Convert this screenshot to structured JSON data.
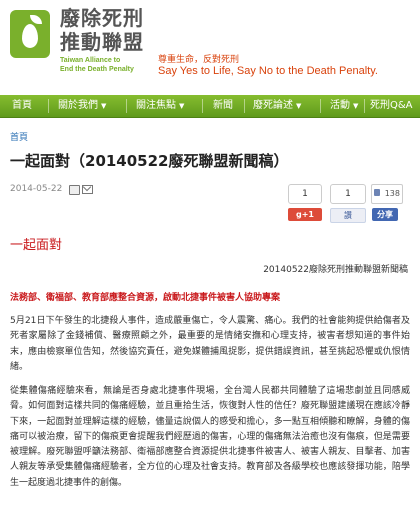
{
  "header": {
    "title": "廢除死刑推動聯盟",
    "title_line1": "廢除死刑",
    "title_line2": "推動聯盟",
    "subtitle_en_line1": "Taiwan Alliance to",
    "subtitle_en_line2": "End the Death Penalty",
    "slogan_zh": "尊重生命，反對死刑",
    "slogan_en": "Say Yes to Life, Say No to the Death Penalty.",
    "brand_color": "#7ab02c",
    "accent_color": "#d9420c"
  },
  "nav": {
    "items": [
      {
        "label": "首頁",
        "has_dropdown": false
      },
      {
        "label": "關於我們",
        "has_dropdown": true
      },
      {
        "label": "關注焦點",
        "has_dropdown": true
      },
      {
        "label": "新聞",
        "has_dropdown": false
      },
      {
        "label": "廢死論述",
        "has_dropdown": true
      },
      {
        "label": "活動",
        "has_dropdown": true
      },
      {
        "label": "死刑Q&A",
        "has_dropdown": false
      }
    ],
    "caret": "▼"
  },
  "breadcrumb": {
    "label": "首頁"
  },
  "article": {
    "title": "一起面對（20140522廢死聯盟新聞稿）",
    "date": "2014-05-22",
    "section_heading": "一起面對",
    "byline": "20140522廢除死刑推動聯盟新聞稿",
    "subheading": "法務部、衛福部、教育部應整合資源，啟動北捷事件被害人協助專案",
    "paragraphs": [
      "5月21日下午發生的北捷殺人事件，造成嚴重傷亡，令人震驚、痛心。我們的社會能夠提供給傷者及死者家屬除了金錢補償、醫療照顧之外，最重要的是情緒安撫和心理支持，被害者想知道的事件始末，應由檢察單位告知，然後協究責任，避免媒體捕風捉影，提供錯誤資訊，甚至挑起恐懼或仇恨情緒。",
      "從集體傷痛經驗來看，無論是否身處北捷事件現場，全台灣人民都共同體驗了這場悲劇並且同感威脅。如何面對這樣共同的傷痛經驗，並且重拾生活，恢復對人性的信任？廢死聯盟建議現在應該冷靜下來，一起面對並理解這樣的經驗，儘量這說個人的感受和擔心，多一點互相傾聽和瞭解，身體的傷痛可以被治療，留下的傷痕更會提醒我們經歷過的傷害，心理的傷痛無法治癒也沒有傷痕，但是需要被理解。廢死聯盟呼籲法務部、衛福部應整合資源提供北捷事件被害人、被害人親友、目擊者、加害人親友等承受集體傷痛經驗者，全方位的心理及社會支持。教育部及各級學校也應該發揮功能，陪學生一起度過北捷事件的創傷。"
    ]
  },
  "share": {
    "count_box_1": "1",
    "count_box_2": "1",
    "gplus_label": "g+1",
    "like_label": "讚",
    "fb_count": "138",
    "fb_share_label": "分享",
    "gplus_color": "#dd4b39",
    "fb_color": "#4267b2"
  },
  "colors": {
    "nav_green": "#7ab02c",
    "heading_red": "#c9191c",
    "link_blue": "#2a6fb3"
  }
}
